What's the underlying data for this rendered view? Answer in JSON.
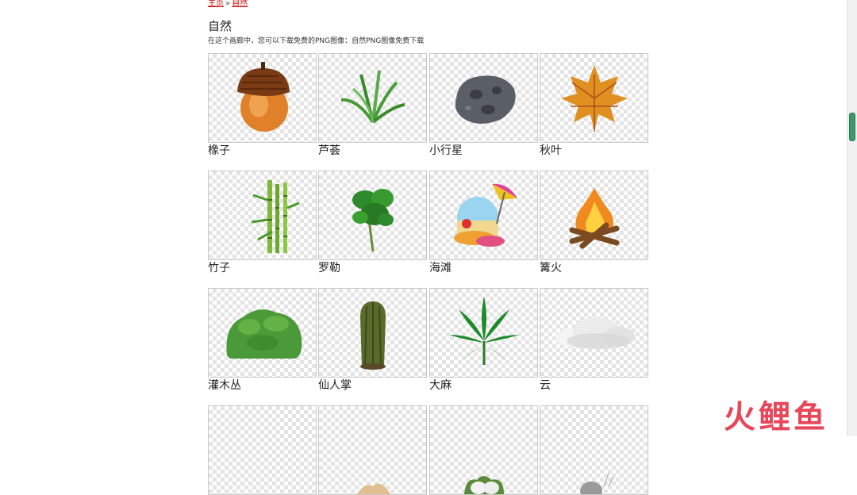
{
  "breadcrumb": {
    "home": "主页",
    "separator": "»",
    "current": "自然"
  },
  "page": {
    "title": "自然",
    "description": "在这个画廊中，您可以下载免费的PNG图像：自然PNG图像免费下载"
  },
  "items": [
    {
      "label": "橡子",
      "icon": "acorn-icon"
    },
    {
      "label": "芦荟",
      "icon": "aloe-icon"
    },
    {
      "label": "小行星",
      "icon": "asteroid-icon"
    },
    {
      "label": "秋叶",
      "icon": "autumn-leaf-icon"
    },
    {
      "label": "竹子",
      "icon": "bamboo-icon"
    },
    {
      "label": "罗勒",
      "icon": "basil-icon"
    },
    {
      "label": "海滩",
      "icon": "beach-icon"
    },
    {
      "label": "篝火",
      "icon": "bonfire-icon"
    },
    {
      "label": "灌木丛",
      "icon": "bush-icon"
    },
    {
      "label": "仙人掌",
      "icon": "cactus-icon"
    },
    {
      "label": "大麻",
      "icon": "cannabis-leaf-icon"
    },
    {
      "label": "云",
      "icon": "cloud-icon"
    }
  ],
  "watermark": "火鲤鱼"
}
